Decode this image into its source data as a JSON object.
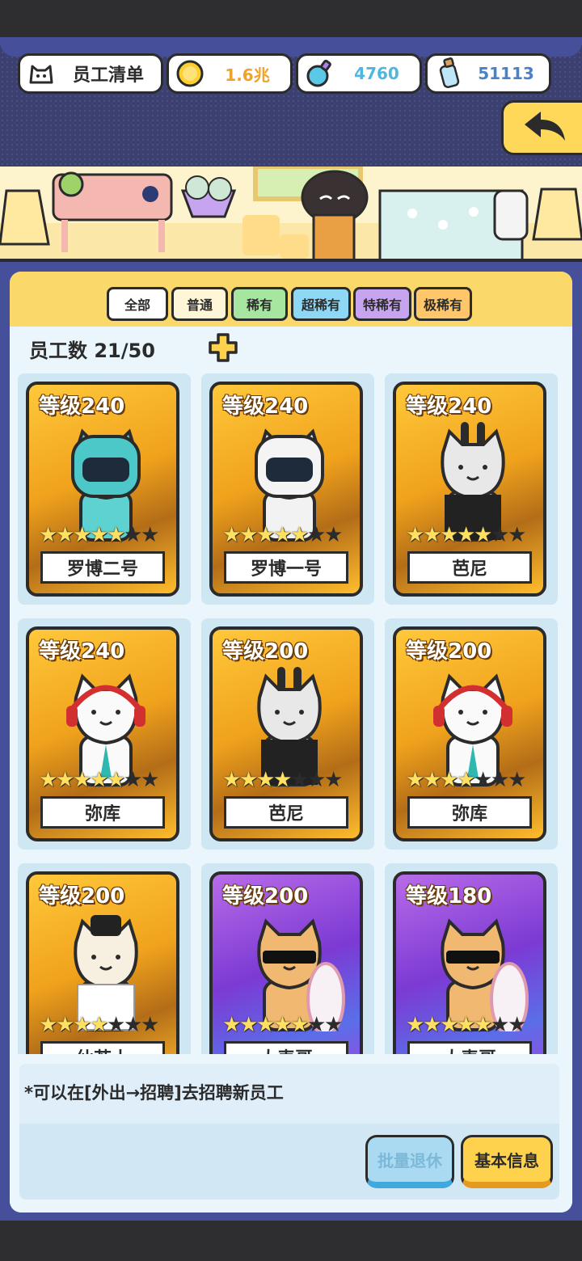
{
  "header": {
    "title": "员工清单",
    "gold": "1.6兆",
    "potion": "4760",
    "bottle": "51113"
  },
  "tabs": [
    {
      "label": "全部",
      "color": "#ffffff"
    },
    {
      "label": "普通",
      "color": "#fff6d8"
    },
    {
      "label": "稀有",
      "color": "#a6e6a0"
    },
    {
      "label": "超稀有",
      "color": "#8fd8f5"
    },
    {
      "label": "特稀有",
      "color": "#c6a4f0"
    },
    {
      "label": "极稀有",
      "color": "#ffc66a"
    }
  ],
  "employee_count": "员工数 21/50",
  "employees": [
    {
      "level": "等级240",
      "name": "罗博二号",
      "stars": 5,
      "rarity": "gold",
      "icon": "robot-cat-teal"
    },
    {
      "level": "等级240",
      "name": "罗博一号",
      "stars": 5,
      "rarity": "gold",
      "icon": "robot-cat-white"
    },
    {
      "level": "等级240",
      "name": "芭尼",
      "stars": 5,
      "rarity": "gold",
      "icon": "bunny-cat"
    },
    {
      "level": "等级240",
      "name": "弥库",
      "stars": 5,
      "rarity": "gold",
      "icon": "headphone-cat"
    },
    {
      "level": "等级200",
      "name": "芭尼",
      "stars": 4,
      "rarity": "gold",
      "icon": "bunny-cat"
    },
    {
      "level": "等级200",
      "name": "弥库",
      "stars": 4,
      "rarity": "gold",
      "icon": "headphone-cat"
    },
    {
      "level": "等级200",
      "name": "仙若士",
      "stars": 4,
      "rarity": "gold",
      "icon": "sage-cat"
    },
    {
      "level": "等级200",
      "name": "大表哥",
      "stars": 5,
      "rarity": "purple",
      "icon": "surfer-cat"
    },
    {
      "level": "等级180",
      "name": "大表哥",
      "stars": 5,
      "rarity": "purple",
      "icon": "surfer-cat"
    }
  ],
  "hint": "*可以在[外出→招聘]去招聘新员工",
  "buttons": {
    "retire": "批量退休",
    "info": "基本信息"
  }
}
